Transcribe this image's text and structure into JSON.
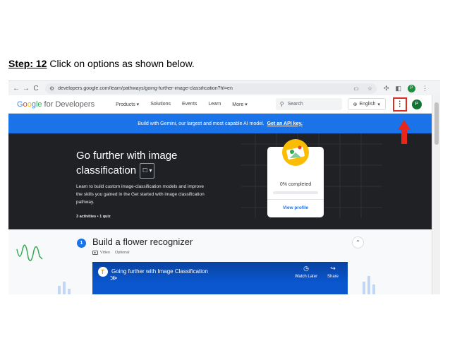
{
  "caption": {
    "step_label": "Step: 12",
    "text": " Click on options as shown below."
  },
  "browser": {
    "back": "←",
    "forward": "→",
    "reload": "C",
    "url": "developers.google.com/learn/pathways/going-further-image-classification?hl=en",
    "profile_initial": "P"
  },
  "site": {
    "logo_g": "G",
    "logo_o1": "o",
    "logo_o2": "o",
    "logo_g2": "g",
    "logo_le": "le",
    "logo_suffix": " for Developers",
    "nav": [
      "Products ▾",
      "Solutions",
      "Events",
      "Learn",
      "More ▾"
    ],
    "search_placeholder": "Search",
    "language": "English",
    "menu_glyph": "⋮",
    "avatar_initial": "P"
  },
  "banner": {
    "text": "Build with Gemini, our largest and most capable AI model.",
    "link": "Get an API key."
  },
  "hero": {
    "title": "Go further with image classification",
    "description": "Learn to build custom image-classification models and improve the skills you gained in the Get started with image classification pathway.",
    "meta": "3 activities • 1 quiz",
    "progress_text": "0% completed",
    "progress_fraction": 0,
    "view_profile": "View profile"
  },
  "section": {
    "number": "1",
    "title": "Build a flower recognizer",
    "type": "Video",
    "optional": "Optional",
    "collapse_glyph": "⌃"
  },
  "video": {
    "title": "Going further with Image Classification",
    "watch_later": "Watch Later",
    "share": "Share"
  },
  "colors": {
    "accent": "#1a73e8",
    "highlight": "#d93025",
    "hero_bg": "#202124"
  }
}
